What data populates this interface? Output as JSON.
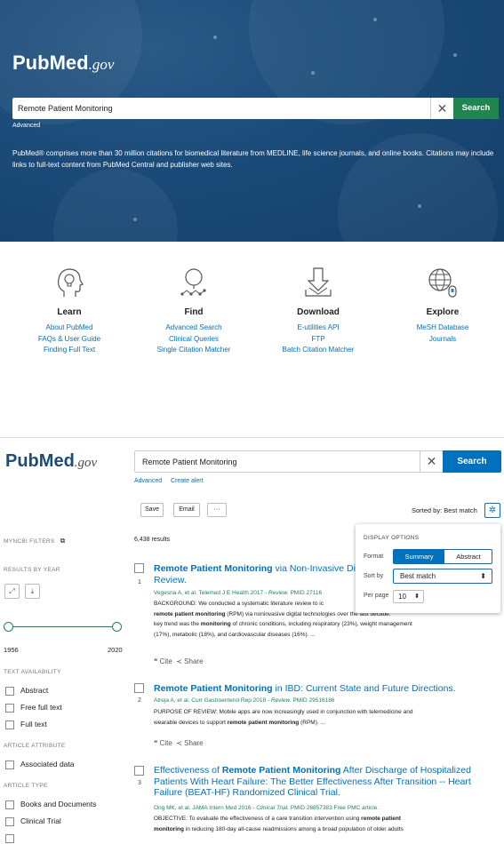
{
  "home": {
    "logo": {
      "pub": "Pub",
      "med": "Med",
      "gov": ".gov"
    },
    "search": {
      "value": "Remote Patient Monitoring",
      "button": "Search",
      "clear": "✕"
    },
    "advanced": "Advanced",
    "description": "PubMed® comprises more than 30 million citations for biomedical literature from MEDLINE, life science journals, and online books. Citations may include links to full-text content from PubMed Central and publisher web sites.",
    "cards": [
      {
        "title": "Learn",
        "icon": "head-lightbulb-icon",
        "links": [
          "About PubMed",
          "FAQs & User Guide",
          "Finding Full Text"
        ]
      },
      {
        "title": "Find",
        "icon": "magnifier-molecule-icon",
        "links": [
          "Advanced Search",
          "Clinical Queries",
          "Single Citation Matcher"
        ]
      },
      {
        "title": "Download",
        "icon": "download-arrow-icon",
        "links": [
          "E-utilities API",
          "FTP",
          "Batch Citation Matcher"
        ]
      },
      {
        "title": "Explore",
        "icon": "globe-mouse-icon",
        "links": [
          "MeSH Database",
          "Journals"
        ]
      }
    ]
  },
  "results_page": {
    "logo": {
      "pub": "Pub",
      "med": "Med",
      "gov": ".gov"
    },
    "search": {
      "value": "Remote Patient Monitoring",
      "button": "Search",
      "clear": "✕"
    },
    "links": {
      "advanced": "Advanced",
      "create_alert": "Create alert"
    },
    "toolbar": {
      "save": "Save",
      "email": "Email",
      "more": "···",
      "sorted_by": "Sorted by: Best match",
      "gear": "✲"
    },
    "count": "6,438 results",
    "sidebar": {
      "myncbi_filters": "MYNCBI FILTERS",
      "results_by_year": "RESULTS BY YEAR",
      "year_start": "1956",
      "year_end": "2020",
      "text_availability": "TEXT AVAILABILITY",
      "text_options": [
        "Abstract",
        "Free full text",
        "Full text"
      ],
      "article_attribute": "ARTICLE ATTRIBUTE",
      "attribute_options": [
        "Associated data"
      ],
      "article_type": "ARTICLE TYPE",
      "type_options": [
        "Books and Documents",
        "Clinical Trial"
      ]
    },
    "results": [
      {
        "num": "1",
        "title_bold": "Remote Patient Monitoring",
        "title_rest": " via Non-Invasive Dig",
        "title_line2": "Review.",
        "cite": "Vegesna A, et al. Telemed J E Health 2017 - ",
        "cite_type": "Review.",
        "cite_pmid": " PMID 27116",
        "snip1": "BACKGROUND: We conducted a systematic literature review to ic",
        "snip1_tail": "key trend over the last decade.",
        "snip2_bold": "remote patient monitoring",
        "snip2_rest": " (RPM) via noninvasive digital technologies over the last decade. ",
        "snip3_pre": "key trend was the ",
        "snip3_bold": "monitoring",
        "snip3_rest": " of chronic conditions, including respiratory (23%), weight management",
        "snip4": "(17%), metabolic (18%), and cardiovascular diseases (16%). ...",
        "cite_action": "Cite",
        "share_action": "Share"
      },
      {
        "num": "2",
        "title_bold": "Remote Patient Monitoring",
        "title_rest": " in IBD: Current State and Future Directions.",
        "cite": "Atreja A, et al. Curr Gastroenterol Rep 2018 - ",
        "cite_type": "Review.",
        "cite_pmid": " PMID 29516186",
        "snip1": "PURPOSE OF REVIEW: Mobile apps are now increasingly used in conjunction with telemedicine and",
        "snip2_pre": "wearable devices to support ",
        "snip2_bold": "remote patient monitoring",
        "snip2_rest": " (RPM). ...",
        "cite_action": "Cite",
        "share_action": "Share"
      },
      {
        "num": "3",
        "title_pre": "Effectiveness of ",
        "title_bold": "Remote Patient Monitoring",
        "title_rest": " After Discharge of Hospitalized",
        "title_line2": "Patients With Heart Failure: The Better Effectiveness After Transition -- Heart",
        "title_line3": "Failure (BEAT-HF) Randomized Clinical Trial.",
        "cite": "Ong MK, et al. JAMA Intern Med 2016 - ",
        "cite_type": "Clinical Trial.",
        "cite_pmid": " PMID 26857383 Free PMC article.",
        "snip1_pre": "OBJECTIVE: To evaluate the effectiveness of a care transition intervention using ",
        "snip1_bold": "remote patient",
        "snip2_bold": "monitoring",
        "snip2_rest": " in reducing 180-day all-cause readmissions among a broad population of older adults"
      }
    ],
    "display_options": {
      "title": "DISPLAY OPTIONS",
      "format_label": "Format",
      "format_options": [
        "Summary",
        "Abstract"
      ],
      "sort_label": "Sort by",
      "sort_value": "Best match",
      "per_page_label": "Per page",
      "per_page_value": "10"
    }
  },
  "colors": {
    "hero_bg": "#1b4c7a",
    "search_green": "#20854f",
    "link_blue": "#0071bc",
    "cite_green": "#20854f"
  }
}
